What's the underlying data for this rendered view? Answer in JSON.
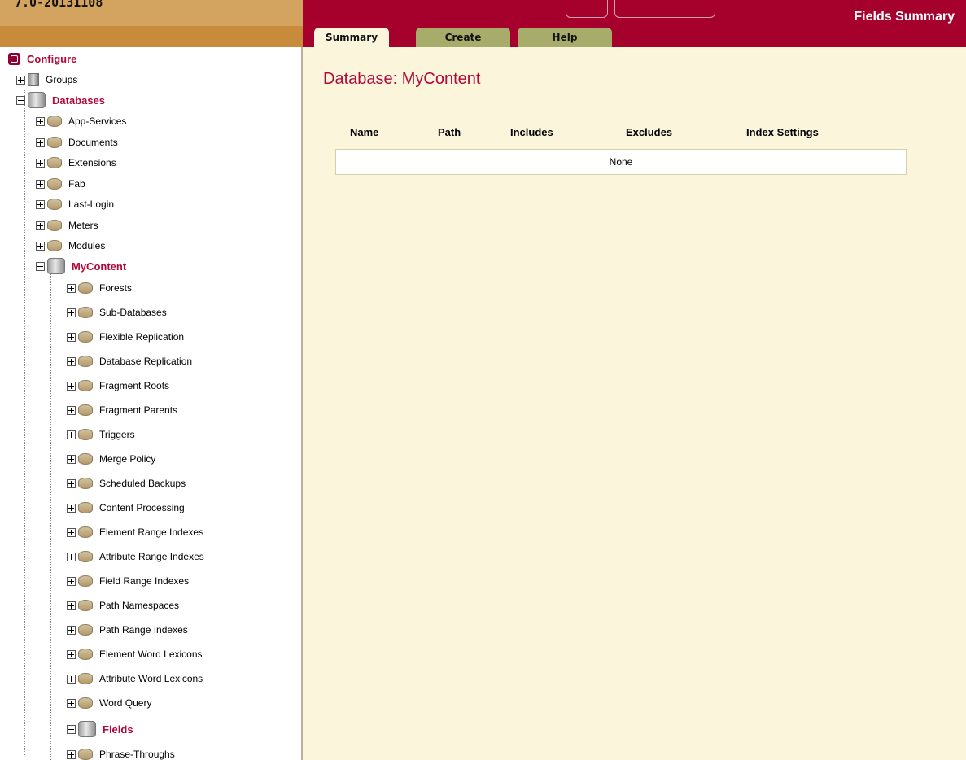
{
  "header": {
    "version": "7.0-20131108",
    "page_heading": "Fields Summary",
    "tabs": [
      {
        "label": "Summary",
        "active": true
      },
      {
        "label": "Create",
        "active": false
      },
      {
        "label": "Help",
        "active": false
      }
    ]
  },
  "sidebar": {
    "configure": "Configure",
    "groups": "Groups",
    "databases": "Databases",
    "db_items": [
      "App-Services",
      "Documents",
      "Extensions",
      "Fab",
      "Last-Login",
      "Meters",
      "Modules"
    ],
    "selected_db": "MyContent",
    "sub_items": [
      "Forests",
      "Sub-Databases",
      "Flexible Replication",
      "Database Replication",
      "Fragment Roots",
      "Fragment Parents",
      "Triggers",
      "Merge Policy",
      "Scheduled Backups",
      "Content Processing",
      "Element Range Indexes",
      "Attribute Range Indexes",
      "Field Range Indexes",
      "Path Namespaces",
      "Path Range Indexes",
      "Element Word Lexicons",
      "Attribute Word Lexicons",
      "Word Query"
    ],
    "fields": "Fields",
    "phrase_throughs": "Phrase-Throughs"
  },
  "main": {
    "title": "Database: MyContent",
    "columns": [
      "Name",
      "Path",
      "Includes",
      "Excludes",
      "Index Settings"
    ],
    "empty_text": "None"
  },
  "colors": {
    "brand": "#a6002d",
    "accent_text": "#b0083a",
    "background": "#fbf5dc",
    "tab_inactive": "#a7ac6a"
  }
}
